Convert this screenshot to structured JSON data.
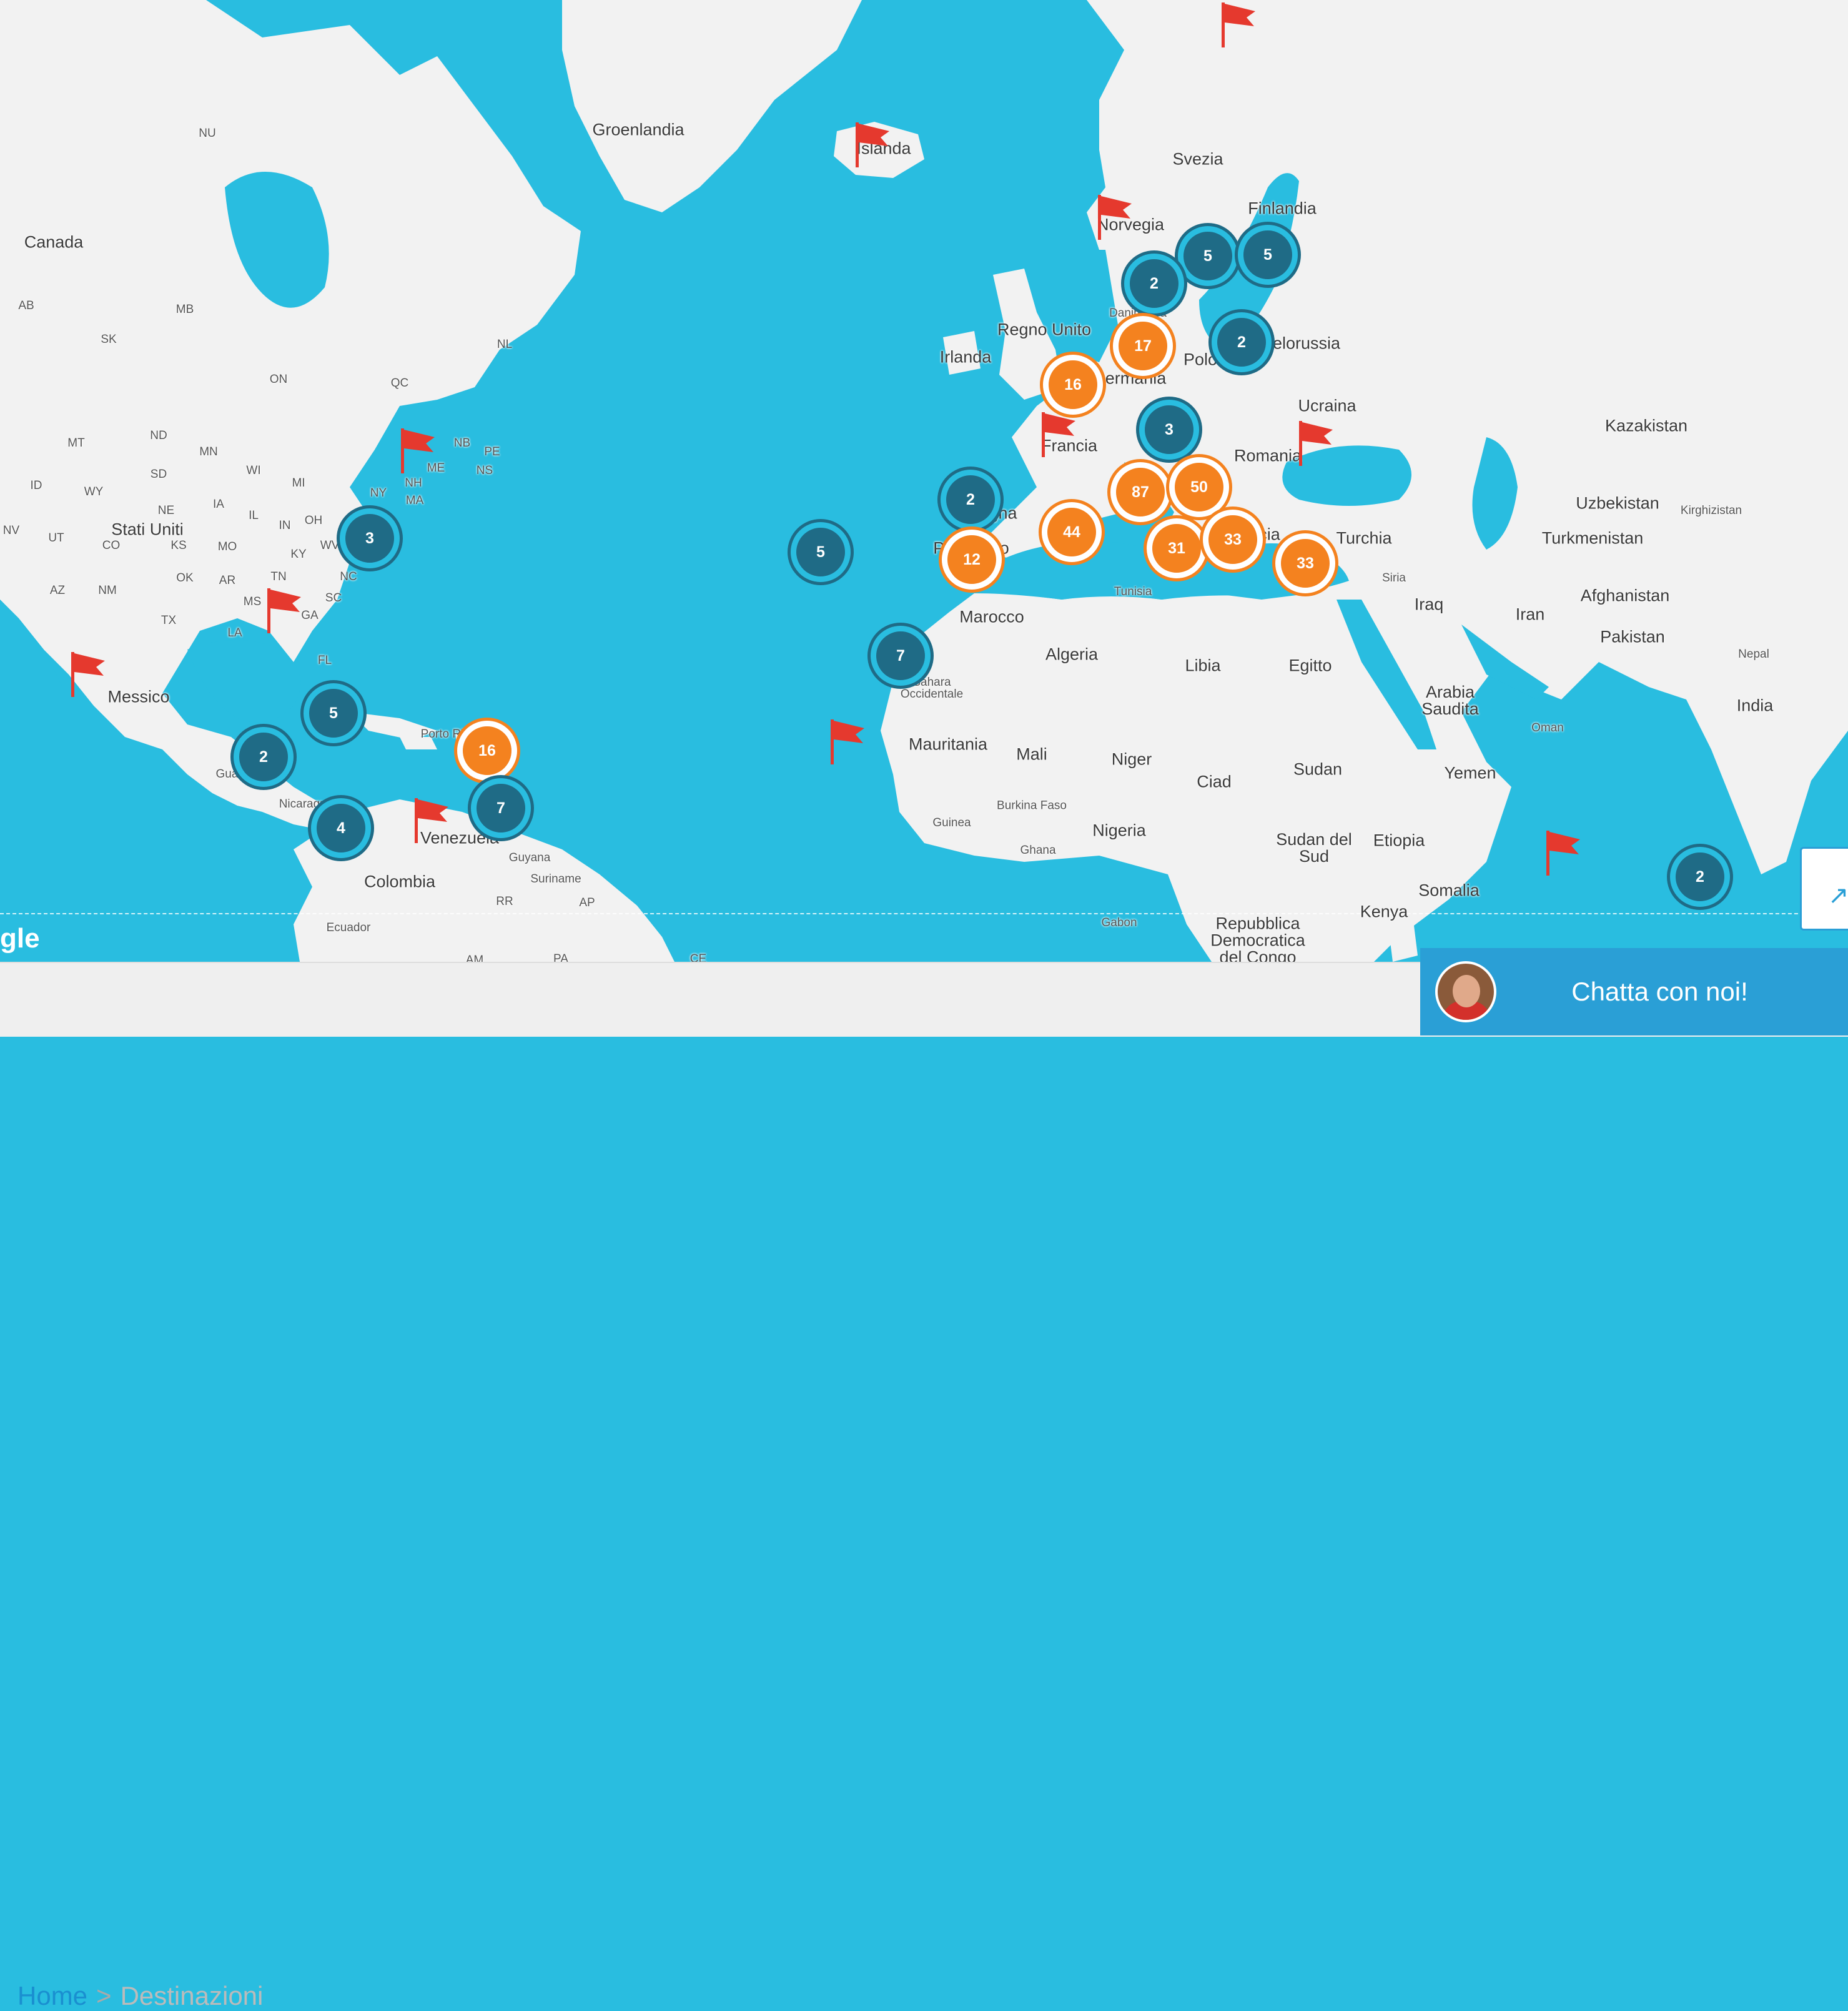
{
  "colors": {
    "water": "#29bde0",
    "land": "#f2f2f2",
    "cluster_blue": "#1f6b86",
    "cluster_orange": "#f4821f",
    "flag": "#e5392e",
    "chat": "#2a9fd6"
  },
  "map": {
    "labels": [
      {
        "id": "groenlandia",
        "text": "Groenlandia",
        "type": "country"
      },
      {
        "id": "islanda",
        "text": "Islanda",
        "type": "country"
      },
      {
        "id": "svezia",
        "text": "Svezia",
        "type": "country"
      },
      {
        "id": "finlandia",
        "text": "Finlandia",
        "type": "country"
      },
      {
        "id": "norvegia",
        "text": "Norvegia",
        "type": "country"
      },
      {
        "id": "canada",
        "text": "Canada",
        "type": "country"
      },
      {
        "id": "danimarca",
        "text": "Danimarca",
        "type": "small"
      },
      {
        "id": "regno-unito",
        "text": "Regno Unito",
        "type": "country"
      },
      {
        "id": "irlanda",
        "text": "Irlanda",
        "type": "country"
      },
      {
        "id": "polonia",
        "text": "Polonia",
        "type": "country"
      },
      {
        "id": "bielorussia",
        "text": "Bielorussia",
        "type": "country"
      },
      {
        "id": "germania",
        "text": "Germania",
        "type": "country"
      },
      {
        "id": "ucraina",
        "text": "Ucraina",
        "type": "country"
      },
      {
        "id": "kazakistan",
        "text": "Kazakistan",
        "type": "country"
      },
      {
        "id": "francia",
        "text": "Francia",
        "type": "country"
      },
      {
        "id": "romania",
        "text": "Romania",
        "type": "country"
      },
      {
        "id": "uzbekistan",
        "text": "Uzbekistan",
        "type": "country"
      },
      {
        "id": "kirghizistan",
        "text": "Kirghizistan",
        "type": "small"
      },
      {
        "id": "spagna",
        "text": "Spagna",
        "type": "country"
      },
      {
        "id": "portogallo",
        "text": "Portogallo",
        "type": "country"
      },
      {
        "id": "turchia",
        "text": "Turchia",
        "type": "country"
      },
      {
        "id": "turkmenistan",
        "text": "Turkmenistan",
        "type": "country"
      },
      {
        "id": "grecia",
        "text": "Grecia",
        "type": "country"
      },
      {
        "id": "tunisia",
        "text": "Tunisia",
        "type": "small"
      },
      {
        "id": "siria",
        "text": "Siria",
        "type": "small"
      },
      {
        "id": "iraq",
        "text": "Iraq",
        "type": "country"
      },
      {
        "id": "iran",
        "text": "Iran",
        "type": "country"
      },
      {
        "id": "afghanistan",
        "text": "Afghanistan",
        "type": "country"
      },
      {
        "id": "marocco",
        "text": "Marocco",
        "type": "country"
      },
      {
        "id": "pakistan",
        "text": "Pakistan",
        "type": "country"
      },
      {
        "id": "algeria",
        "text": "Algeria",
        "type": "country"
      },
      {
        "id": "libia",
        "text": "Libia",
        "type": "country"
      },
      {
        "id": "egitto",
        "text": "Egitto",
        "type": "country"
      },
      {
        "id": "nepal",
        "text": "Nepal",
        "type": "small"
      },
      {
        "id": "sahara",
        "text": "Sahara Occidentale",
        "type": "small"
      },
      {
        "id": "arabia",
        "text": "Arabia Saudita",
        "type": "country"
      },
      {
        "id": "india",
        "text": "India",
        "type": "country"
      },
      {
        "id": "oman",
        "text": "Oman",
        "type": "small"
      },
      {
        "id": "mauritania",
        "text": "Mauritania",
        "type": "country"
      },
      {
        "id": "mali",
        "text": "Mali",
        "type": "country"
      },
      {
        "id": "niger",
        "text": "Niger",
        "type": "country"
      },
      {
        "id": "ciad",
        "text": "Ciad",
        "type": "country"
      },
      {
        "id": "sudan",
        "text": "Sudan",
        "type": "country"
      },
      {
        "id": "yemen",
        "text": "Yemen",
        "type": "country"
      },
      {
        "id": "burkina",
        "text": "Burkina Faso",
        "type": "small"
      },
      {
        "id": "guinea",
        "text": "Guinea",
        "type": "small"
      },
      {
        "id": "nigeria",
        "text": "Nigeria",
        "type": "country"
      },
      {
        "id": "ghana",
        "text": "Ghana",
        "type": "small"
      },
      {
        "id": "sudan-sud",
        "text": "Sudan del Sud",
        "type": "country"
      },
      {
        "id": "etiopia",
        "text": "Etiopia",
        "type": "country"
      },
      {
        "id": "somalia",
        "text": "Somalia",
        "type": "country"
      },
      {
        "id": "kenya",
        "text": "Kenya",
        "type": "country"
      },
      {
        "id": "gabon",
        "text": "Gabon",
        "type": "small"
      },
      {
        "id": "congo",
        "text": "Repubblica Democratica del Congo",
        "type": "country"
      },
      {
        "id": "stati-uniti",
        "text": "Stati Uniti",
        "type": "country"
      },
      {
        "id": "messico",
        "text": "Messico",
        "type": "country"
      },
      {
        "id": "guatemala",
        "text": "Guatemala",
        "type": "small"
      },
      {
        "id": "nicaragua",
        "text": "Nicaragua",
        "type": "small"
      },
      {
        "id": "porto-rico",
        "text": "Porto Rico",
        "type": "small"
      },
      {
        "id": "venezuela",
        "text": "Venezuela",
        "type": "country"
      },
      {
        "id": "guyana",
        "text": "Guyana",
        "type": "small"
      },
      {
        "id": "suriname",
        "text": "Suriname",
        "type": "small"
      },
      {
        "id": "colombia",
        "text": "Colombia",
        "type": "country"
      },
      {
        "id": "ecuador",
        "text": "Ecuador",
        "type": "small"
      },
      {
        "id": "nu",
        "text": "NU",
        "type": "small"
      },
      {
        "id": "ab",
        "text": "AB",
        "type": "small"
      },
      {
        "id": "mb",
        "text": "MB",
        "type": "small"
      },
      {
        "id": "sk",
        "text": "SK",
        "type": "small"
      },
      {
        "id": "on",
        "text": "ON",
        "type": "small"
      },
      {
        "id": "qc",
        "text": "QC",
        "type": "small"
      },
      {
        "id": "nl",
        "text": "NL",
        "type": "small"
      },
      {
        "id": "nb",
        "text": "NB",
        "type": "small"
      },
      {
        "id": "pe",
        "text": "PE",
        "type": "small"
      },
      {
        "id": "ns",
        "text": "NS",
        "type": "small"
      },
      {
        "id": "mt",
        "text": "MT",
        "type": "small"
      },
      {
        "id": "nd",
        "text": "ND",
        "type": "small"
      },
      {
        "id": "mn",
        "text": "MN",
        "type": "small"
      },
      {
        "id": "sd",
        "text": "SD",
        "type": "small"
      },
      {
        "id": "wi",
        "text": "WI",
        "type": "small"
      },
      {
        "id": "mi",
        "text": "MI",
        "type": "small"
      },
      {
        "id": "ny",
        "text": "NY",
        "type": "small"
      },
      {
        "id": "me",
        "text": "ME",
        "type": "small"
      },
      {
        "id": "nh",
        "text": "NH",
        "type": "small"
      },
      {
        "id": "ma",
        "text": "MA",
        "type": "small"
      },
      {
        "id": "id",
        "text": "ID",
        "type": "small"
      },
      {
        "id": "wy",
        "text": "WY",
        "type": "small"
      },
      {
        "id": "ne",
        "text": "NE",
        "type": "small"
      },
      {
        "id": "ia",
        "text": "IA",
        "type": "small"
      },
      {
        "id": "il",
        "text": "IL",
        "type": "small"
      },
      {
        "id": "in",
        "text": "IN",
        "type": "small"
      },
      {
        "id": "oh",
        "text": "OH",
        "type": "small"
      },
      {
        "id": "nv",
        "text": "NV",
        "type": "small"
      },
      {
        "id": "ut",
        "text": "UT",
        "type": "small"
      },
      {
        "id": "co",
        "text": "CO",
        "type": "small"
      },
      {
        "id": "ks",
        "text": "KS",
        "type": "small"
      },
      {
        "id": "mo",
        "text": "MO",
        "type": "small"
      },
      {
        "id": "ky",
        "text": "KY",
        "type": "small"
      },
      {
        "id": "wv",
        "text": "WV",
        "type": "small"
      },
      {
        "id": "az",
        "text": "AZ",
        "type": "small"
      },
      {
        "id": "nm",
        "text": "NM",
        "type": "small"
      },
      {
        "id": "ok",
        "text": "OK",
        "type": "small"
      },
      {
        "id": "ar",
        "text": "AR",
        "type": "small"
      },
      {
        "id": "tn",
        "text": "TN",
        "type": "small"
      },
      {
        "id": "nc",
        "text": "NC",
        "type": "small"
      },
      {
        "id": "tx",
        "text": "TX",
        "type": "small"
      },
      {
        "id": "ms",
        "text": "MS",
        "type": "small"
      },
      {
        "id": "ga",
        "text": "GA",
        "type": "small"
      },
      {
        "id": "sc",
        "text": "SC",
        "type": "small"
      },
      {
        "id": "la",
        "text": "LA",
        "type": "small"
      },
      {
        "id": "fl",
        "text": "FL",
        "type": "small"
      },
      {
        "id": "rr",
        "text": "RR",
        "type": "small"
      },
      {
        "id": "ap",
        "text": "AP",
        "type": "small"
      },
      {
        "id": "am",
        "text": "AM",
        "type": "small"
      },
      {
        "id": "pa",
        "text": "PA",
        "type": "small"
      },
      {
        "id": "ce",
        "text": "CE",
        "type": "small"
      }
    ],
    "clusters": [
      {
        "id": "sweden-5",
        "count": "5",
        "color": "blue"
      },
      {
        "id": "finland-5",
        "count": "5",
        "color": "blue"
      },
      {
        "id": "denmark-2",
        "count": "2",
        "color": "blue"
      },
      {
        "id": "baltic-2",
        "count": "2",
        "color": "blue"
      },
      {
        "id": "germany-17",
        "count": "17",
        "color": "orange"
      },
      {
        "id": "uk-16",
        "count": "16",
        "color": "orange"
      },
      {
        "id": "austria-3",
        "count": "3",
        "color": "blue"
      },
      {
        "id": "italy-87",
        "count": "87",
        "color": "orange"
      },
      {
        "id": "balkans-50",
        "count": "50",
        "color": "orange"
      },
      {
        "id": "spain-2",
        "count": "2",
        "color": "blue"
      },
      {
        "id": "baleari-44",
        "count": "44",
        "color": "orange"
      },
      {
        "id": "portugal-12",
        "count": "12",
        "color": "orange"
      },
      {
        "id": "sicily-31",
        "count": "31",
        "color": "orange"
      },
      {
        "id": "greece-33",
        "count": "33",
        "color": "orange"
      },
      {
        "id": "turkey-33",
        "count": "33",
        "color": "orange"
      },
      {
        "id": "azores-5",
        "count": "5",
        "color": "blue"
      },
      {
        "id": "canarie-7",
        "count": "7",
        "color": "blue"
      },
      {
        "id": "usa-east-3",
        "count": "3",
        "color": "blue"
      },
      {
        "id": "cuba-5",
        "count": "5",
        "color": "blue"
      },
      {
        "id": "guatemala-2",
        "count": "2",
        "color": "blue"
      },
      {
        "id": "caribbean-16",
        "count": "16",
        "color": "orange"
      },
      {
        "id": "antilles-7",
        "count": "7",
        "color": "blue"
      },
      {
        "id": "costarica-4",
        "count": "4",
        "color": "blue"
      },
      {
        "id": "maldives-2",
        "count": "2",
        "color": "blue"
      }
    ],
    "flags": [
      "norway-north",
      "iceland",
      "norway",
      "france",
      "romania",
      "usa-northeast",
      "usa-south",
      "mexico-baja",
      "colombia",
      "cape-verde",
      "seychelles"
    ]
  },
  "google_logo": "gle",
  "breadcrumb": {
    "home": "Home",
    "separator": ">",
    "current": "Destinazioni"
  },
  "chat": {
    "label": "Chatta con noi!"
  },
  "side_widget": {
    "icon": "arrow-up-icon"
  }
}
